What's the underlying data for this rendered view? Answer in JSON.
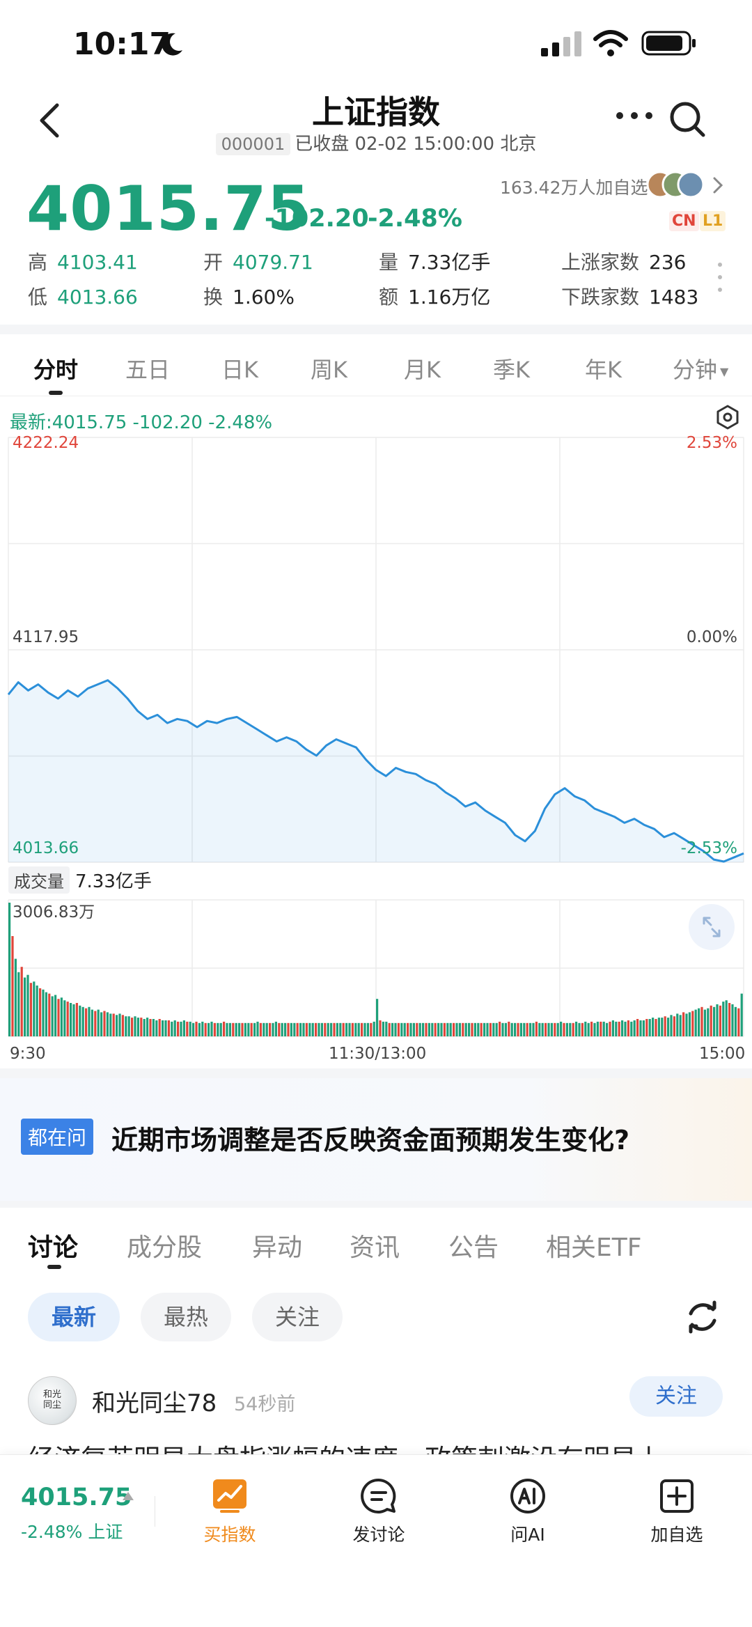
{
  "status_bar": {
    "time": "10:17"
  },
  "header": {
    "title": "上证指数",
    "code": "000001",
    "status": "已收盘 02-02 15:00:00 北京"
  },
  "quote": {
    "price": "4015.75",
    "change": "-102.20",
    "change_pct": "-2.48%",
    "followers": "163.42万人加自选",
    "badges": [
      "CN",
      "L1"
    ],
    "stats": [
      {
        "label": "高",
        "value": "4103.41"
      },
      {
        "label": "开",
        "value": "4079.71"
      },
      {
        "label": "量",
        "value": "7.33亿手"
      },
      {
        "label": "上涨家数",
        "value": "236"
      },
      {
        "label": "低",
        "value": "4013.66"
      },
      {
        "label": "换",
        "value": "1.60%"
      },
      {
        "label": "额",
        "value": "1.16万亿"
      },
      {
        "label": "下跌家数",
        "value": "1483"
      }
    ]
  },
  "chart_tabs": [
    "分时",
    "五日",
    "日K",
    "周K",
    "月K",
    "季K",
    "年K",
    "分钟"
  ],
  "chart_header": {
    "latest": "最新:4015.75  -102.20  -2.48%"
  },
  "colors": {
    "up": "#e0453a",
    "down": "#1ea07a",
    "line": "#2b8fd9",
    "accent": "#f08a1c"
  },
  "chart_data": {
    "type": "line",
    "y_left_ticks": [
      "4222.24",
      "4117.95",
      "4013.66"
    ],
    "y_right_ticks": [
      "2.53%",
      "0.00%",
      "-2.53%"
    ],
    "ylim": [
      4013.66,
      4222.24
    ],
    "x_ticks": [
      "9:30",
      "11:30/13:00",
      "15:00"
    ],
    "series": [
      {
        "values": [
          4096,
          4102,
          4098,
          4101,
          4097,
          4094,
          4098,
          4095,
          4099,
          4101,
          4103,
          4099,
          4094,
          4088,
          4084,
          4086,
          4082,
          4084,
          4083,
          4080,
          4083,
          4082,
          4084,
          4085,
          4082,
          4079,
          4076,
          4073,
          4075,
          4073,
          4069,
          4066,
          4071,
          4074,
          4072,
          4070,
          4064,
          4059,
          4056,
          4060,
          4058,
          4057,
          4054,
          4052,
          4048,
          4045,
          4041,
          4043,
          4039,
          4036,
          4033,
          4027,
          4024,
          4029,
          4040,
          4047,
          4050,
          4046,
          4044,
          4040,
          4038,
          4036,
          4033,
          4035,
          4032,
          4030,
          4026,
          4028,
          4025,
          4022,
          4019,
          4015,
          4014,
          4016,
          4018
        ]
      }
    ],
    "volume": {
      "label": "成交量",
      "total": "7.33亿手",
      "max_label": "3006.83万",
      "values": [
        100,
        75,
        58,
        48,
        52,
        44,
        46,
        40,
        41,
        38,
        36,
        35,
        33,
        32,
        30,
        31,
        28,
        29,
        27,
        26,
        25,
        24,
        25,
        23,
        22,
        21,
        22,
        20,
        19,
        20,
        18,
        19,
        18,
        17,
        17,
        16,
        17,
        16,
        15,
        15,
        14,
        15,
        14,
        14,
        13,
        14,
        13,
        13,
        12,
        13,
        12,
        12,
        12,
        11,
        12,
        11,
        11,
        12,
        11,
        11,
        10,
        11,
        10,
        11,
        10,
        10,
        11,
        10,
        10,
        10,
        11,
        10,
        10,
        10,
        10,
        10,
        10,
        10,
        10,
        10,
        10,
        11,
        10,
        10,
        10,
        10,
        10,
        11,
        10,
        10,
        10,
        10,
        10,
        10,
        10,
        10,
        10,
        10,
        10,
        10,
        10,
        10,
        10,
        10,
        10,
        10,
        10,
        10,
        10,
        10,
        10,
        10,
        10,
        10,
        10,
        10,
        10,
        10,
        10,
        11,
        28,
        12,
        11,
        11,
        10,
        10,
        10,
        10,
        10,
        10,
        10,
        10,
        10,
        10,
        10,
        10,
        10,
        10,
        10,
        10,
        10,
        10,
        10,
        10,
        10,
        10,
        10,
        10,
        10,
        10,
        10,
        10,
        10,
        10,
        10,
        10,
        10,
        10,
        10,
        10,
        11,
        10,
        10,
        11,
        10,
        10,
        10,
        10,
        10,
        10,
        10,
        10,
        11,
        10,
        10,
        10,
        10,
        10,
        10,
        10,
        11,
        10,
        10,
        10,
        10,
        11,
        10,
        10,
        11,
        10,
        11,
        10,
        11,
        11,
        11,
        10,
        11,
        12,
        11,
        11,
        12,
        11,
        12,
        11,
        12,
        13,
        12,
        12,
        13,
        13,
        14,
        13,
        14,
        14,
        15,
        14,
        16,
        15,
        17,
        16,
        18,
        17,
        18,
        19,
        20,
        21,
        22,
        20,
        21,
        23,
        22,
        24,
        23,
        26,
        27,
        25,
        24,
        22,
        21,
        32
      ]
    }
  },
  "banner": {
    "tag": "都在问",
    "text": "近期市场调整是否反映资金面预期发生变化?"
  },
  "discussion_tabs": [
    "讨论",
    "成分股",
    "异动",
    "资讯",
    "公告",
    "相关ETF"
  ],
  "filters": [
    "最新",
    "最热",
    "关注"
  ],
  "post": {
    "avatar_text": "和光同尘",
    "username": "和光同尘78",
    "time": "54秒前",
    "follow_label": "关注",
    "text": "经济复苏明显大盘指涨幅的速度，政策刺激没有明显上"
  },
  "bottom_bar": {
    "price": "4015.75",
    "change_pct": "-2.48%",
    "index_name": "上证",
    "buttons": [
      {
        "label": "买指数",
        "icon": "chart-up-icon"
      },
      {
        "label": "发讨论",
        "icon": "comment-icon"
      },
      {
        "label": "问AI",
        "icon": "ai-icon"
      },
      {
        "label": "加自选",
        "icon": "plus-square-icon"
      }
    ]
  }
}
